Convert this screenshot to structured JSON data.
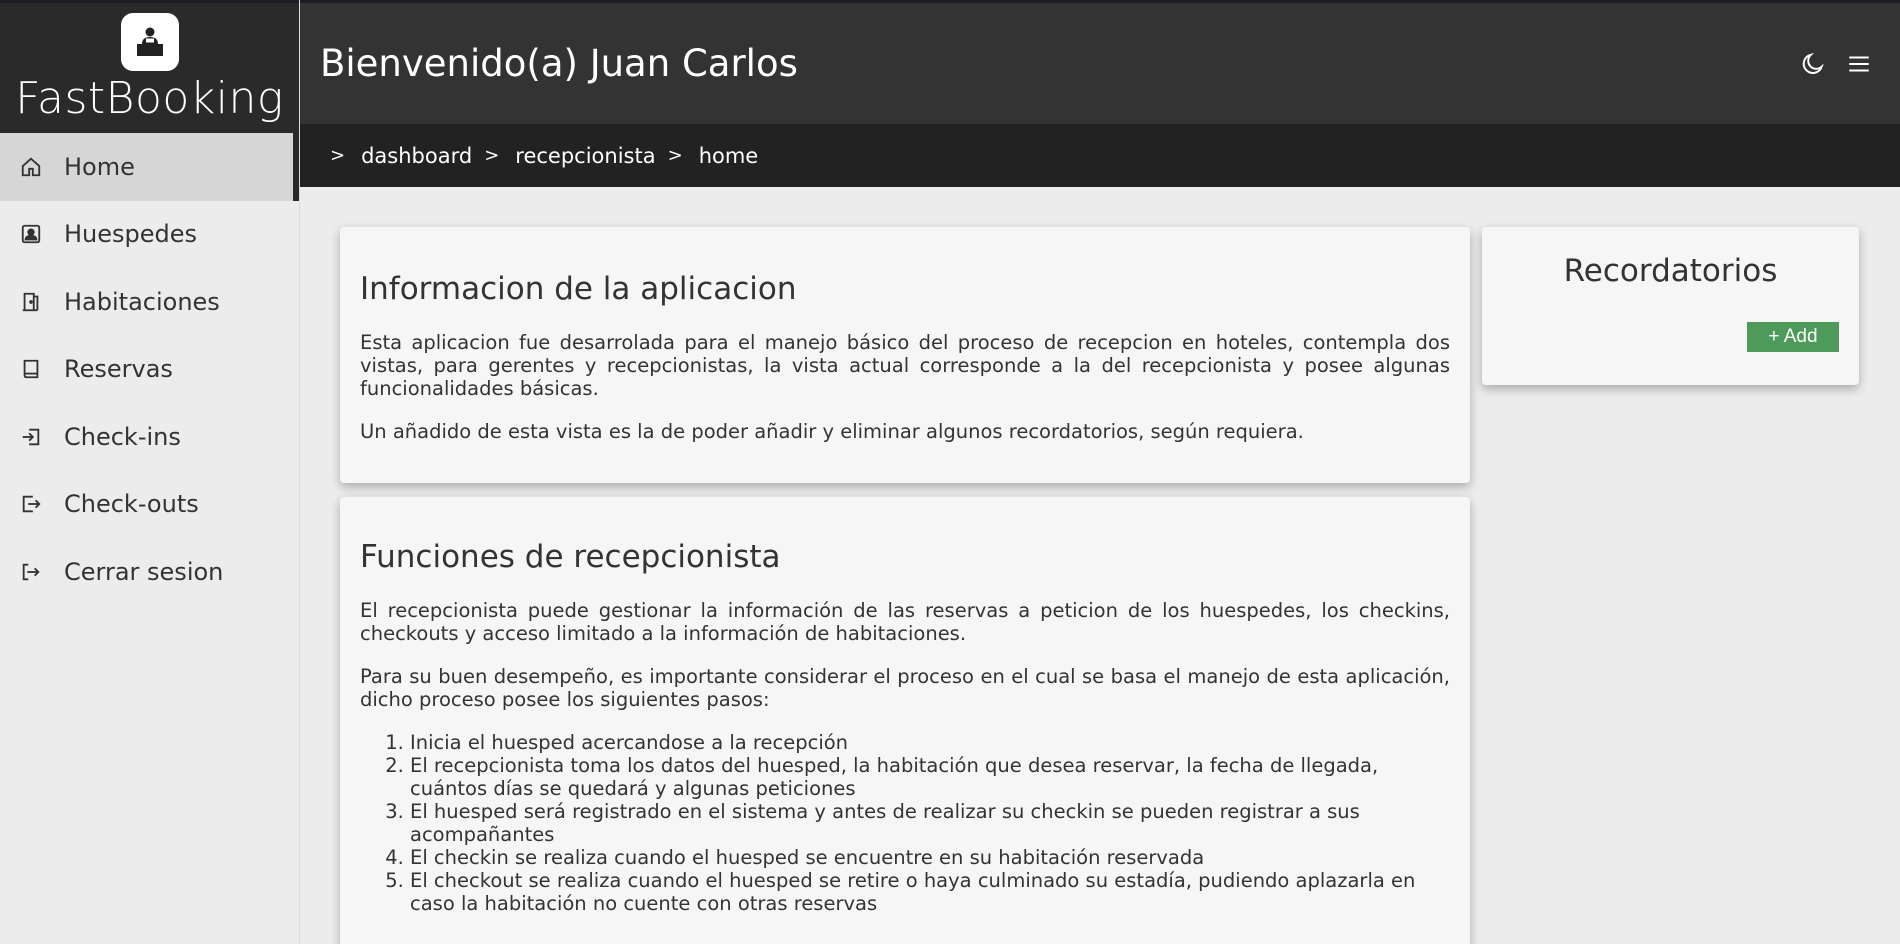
{
  "brand": {
    "name": "FastBooking",
    "logo_icon": "receptionist-desk-icon"
  },
  "sidebar": {
    "items": [
      {
        "label": "Home",
        "icon": "home-icon",
        "active": true
      },
      {
        "label": "Huespedes",
        "icon": "contact-card-icon"
      },
      {
        "label": "Habitaciones",
        "icon": "door-icon"
      },
      {
        "label": "Reservas",
        "icon": "book-icon"
      },
      {
        "label": "Check-ins",
        "icon": "sign-in-icon"
      },
      {
        "label": "Check-outs",
        "icon": "sign-out-box-icon"
      },
      {
        "label": "Cerrar sesion",
        "icon": "logout-icon"
      }
    ]
  },
  "header": {
    "welcome": "Bienvenido(a) Juan Carlos",
    "icons": [
      "moon-icon",
      "hamburger-menu-icon"
    ]
  },
  "breadcrumb": [
    "dashboard",
    "recepcionista",
    "home"
  ],
  "info_card": {
    "title": "Informacion de la aplicacion",
    "paragraphs": [
      "Esta aplicacion fue desarrolada para el manejo básico del proceso de recepcion en hoteles, contempla dos vistas, para gerentes y recepcionistas, la vista actual corresponde a la del recepcionista y posee algunas funcionalidades básicas.",
      "Un añadido de esta vista es la de poder añadir y eliminar algunos recordatorios, según requiera."
    ]
  },
  "functions_card": {
    "title": "Funciones de recepcionista",
    "paragraphs": [
      "El recepcionista puede gestionar la información de las reservas a peticion de los huespedes, los checkins, checkouts y acceso limitado a la información de habitaciones.",
      "Para su buen desempeño, es importante considerar el proceso en el cual se basa el manejo de esta aplicación, dicho proceso posee los siguientes pasos:"
    ],
    "steps": [
      "Inicia el huesped acercandose a la recepción",
      "El recepcionista toma los datos del huesped, la habitación que desea reservar, la fecha de llegada, cuántos días se quedará y algunas peticiones",
      "El huesped será registrado en el sistema y antes de realizar su checkin se pueden registrar a sus acompañantes",
      "El checkin se realiza cuando el huesped se encuentre en su habitación reservada",
      "El checkout se realiza cuando el huesped se retire o haya culminado su estadía, pudiendo aplazarla en caso la habitación no cuente con otras reservas"
    ]
  },
  "reminders": {
    "title": "Recordatorios",
    "add_label": "+ Add",
    "add_color": "#4e9a5a"
  }
}
